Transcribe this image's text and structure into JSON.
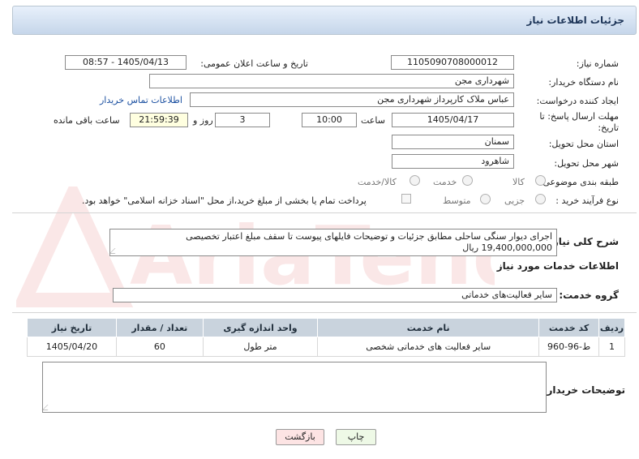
{
  "header": {
    "title": "جزئیات اطلاعات نیاز"
  },
  "form": {
    "need_number": {
      "label": "شماره نیاز:",
      "value": "1105090708000012"
    },
    "announce_datetime": {
      "label": "تاریخ و ساعت اعلان عمومی:",
      "value": "1405/04/13 - 08:57"
    },
    "buyer_org": {
      "label": "نام دستگاه خریدار:",
      "value": "شهرداری مجن"
    },
    "requester": {
      "label": "ایجاد کننده درخواست:",
      "value": "عباس ملاک کارپرداز شهرداری مجن",
      "contact_link": "اطلاعات تماس خریدار"
    },
    "deadline": {
      "label": "مهلت ارسال پاسخ: تا تاریخ:",
      "date": "1405/04/17",
      "time_label": "ساعت",
      "time": "10:00",
      "days": "3",
      "days_label": "روز و",
      "remaining": "21:59:39",
      "remaining_label": "ساعت باقی مانده"
    },
    "delivery_province": {
      "label": "استان محل تحویل:",
      "value": "سمنان"
    },
    "delivery_city": {
      "label": "شهر محل تحویل:",
      "value": "شاهرود"
    },
    "category": {
      "label": "طبقه بندی موضوعی:",
      "options": [
        "کالا",
        "خدمت",
        "کالا/خدمت"
      ]
    },
    "purchase_type": {
      "label": "نوع فرآیند خرید :",
      "options": [
        "جزیی",
        "متوسط"
      ],
      "payment_note": "پرداخت تمام یا بخشی از مبلغ خرید،از محل \"اسناد خزانه اسلامی\" خواهد بود."
    },
    "description": {
      "label": "شرح کلی نیاز:",
      "value": "اجرای دیوار سنگی ساحلی مطابق جزئیات و توضیحات فایلهای پیوست تا سقف مبلغ اعتبار تخصیصی 19,400,000,000 ریال"
    },
    "services_heading": "اطلاعات خدمات مورد نیاز",
    "service_group": {
      "label": "گروه خدمت:",
      "value": "سایر فعالیت‌های خدماتی"
    },
    "buyer_notes": {
      "label": "توضیحات خریدار:",
      "value": ""
    }
  },
  "table": {
    "headers": [
      "ردیف",
      "کد خدمت",
      "نام خدمت",
      "واحد اندازه گیری",
      "تعداد / مقدار",
      "تاریخ نیاز"
    ],
    "rows": [
      [
        "1",
        "ط-96-960",
        "سایر فعالیت های خدماتی شخصی",
        "متر طول",
        "60",
        "1405/04/20"
      ]
    ]
  },
  "buttons": {
    "print": "چاپ",
    "back": "بازگشت"
  },
  "watermark": {
    "text": "AriaTender.net"
  },
  "colors": {
    "header_bg": "#c6d6ea",
    "header_text": "#1e3659",
    "link": "#1a4fa0",
    "highlight": "#ffffe0"
  }
}
